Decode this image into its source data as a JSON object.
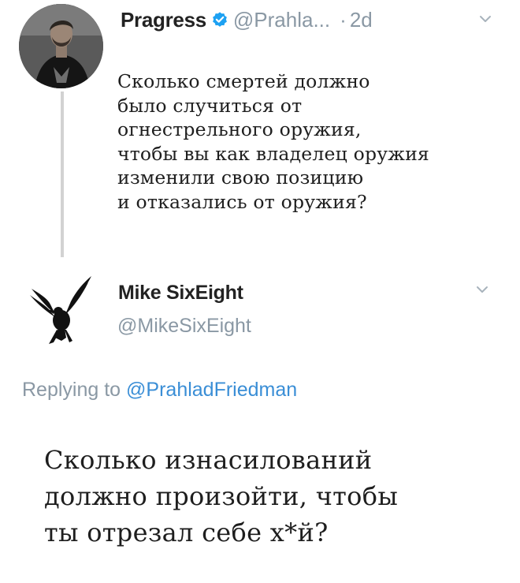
{
  "original_tweet": {
    "display_name": "Pragress",
    "handle": "@Prahla...",
    "separator": "·",
    "time": "2d",
    "text_lines": [
      "Сколько смертей должно",
      "было случиться от",
      "огнестрельного оружия,",
      "чтобы вы как владелец оружия",
      "изменили свою позицию",
      "и отказались от оружия?"
    ]
  },
  "reply": {
    "display_name": "Mike SixEight",
    "handle": "@MikeSixEight",
    "replying_prefix": "Replying to",
    "replying_mention": "@PrahladFriedman",
    "text_lines": [
      "Сколько изнасилований",
      "должно произойти, чтобы",
      "ты отрезал себе х*й?"
    ]
  },
  "icons": {
    "verified": "verified-badge-icon",
    "more": "chevron-down-icon",
    "crow": "crow-avatar-icon"
  },
  "colors": {
    "verified_blue": "#1da1f2",
    "secondary_text": "#8a98a4",
    "thread_line": "#d2d2d2"
  }
}
